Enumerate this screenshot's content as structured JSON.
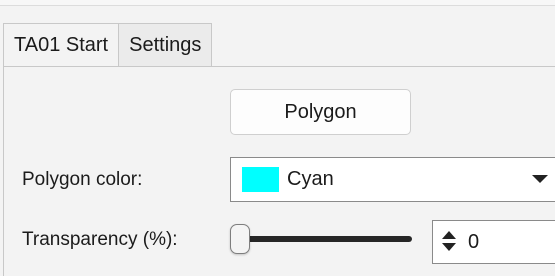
{
  "tabs": [
    {
      "label": "TA01 Start",
      "active": false
    },
    {
      "label": "Settings",
      "active": true
    }
  ],
  "buttons": {
    "polygon_label": "Polygon"
  },
  "polygon_color": {
    "label": "Polygon color:",
    "selected": "Cyan",
    "swatch_color": "#00ffff",
    "dropdown_icon": "chevron-down-icon"
  },
  "transparency": {
    "label": "Transparency (%):",
    "slider_value_percent": 0,
    "value": "0",
    "spinner_icon": "up-down-arrows-icon"
  }
}
